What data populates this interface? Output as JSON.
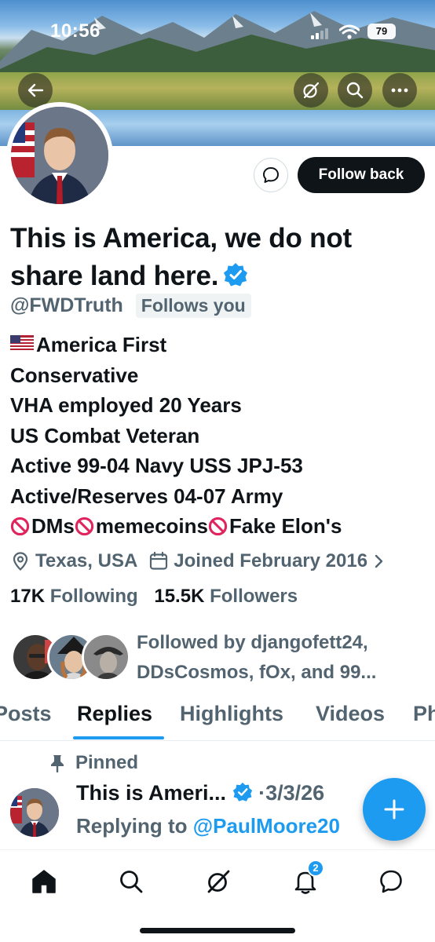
{
  "status_bar": {
    "time": "10:56",
    "battery": "79"
  },
  "profile": {
    "name": "This is America, we do not share land here.",
    "handle": "@FWDTruth",
    "follows_you": "Follows you",
    "follow_button": "Follow back",
    "bio": {
      "line1": "America First",
      "line2": "Conservative",
      "line3": "VHA employed 20 Years",
      "line4": "US Combat Veteran",
      "line5": "Active 99-04 Navy USS JPJ-53",
      "line6": "Active/Reserves 04-07 Army",
      "line7_a": "DMs",
      "line7_b": "memecoins",
      "line7_c": "Fake Elon's"
    },
    "location": "Texas, USA",
    "joined": "Joined February 2016",
    "following_count": "17K",
    "following_label": "Following",
    "followers_count": "15.5K",
    "followers_label": "Followers",
    "followed_by_line1": "Followed by djangofett24,",
    "followed_by_line2": "DDsCosmos, fOx, and 99..."
  },
  "tabs": [
    {
      "label": "Posts"
    },
    {
      "label": "Replies"
    },
    {
      "label": "Highlights"
    },
    {
      "label": "Videos"
    },
    {
      "label": "Ph"
    }
  ],
  "active_tab": "Replies",
  "pinned_post": {
    "pinned_label": "Pinned",
    "author": "This is Ameri...",
    "date": "·3/3/26",
    "replying_to_label": "Replying to",
    "replying_to_handle": "@PaulMoore20"
  },
  "bottom_nav": {
    "notifications_badge": "2"
  },
  "colors": {
    "accent": "#1d9bf0",
    "text_primary": "#0f1419",
    "text_secondary": "#536471",
    "nope": "#e0245e"
  },
  "icons": {
    "back": "back-arrow-icon",
    "grok": "grok-icon",
    "search": "search-icon",
    "more": "more-icon",
    "message": "message-icon",
    "verified": "verified-badge-icon",
    "location": "location-pin-icon",
    "calendar": "calendar-icon",
    "pin": "pin-icon",
    "compose": "plus-icon",
    "home": "home-icon",
    "bell": "bell-icon",
    "chat": "chat-icon"
  }
}
